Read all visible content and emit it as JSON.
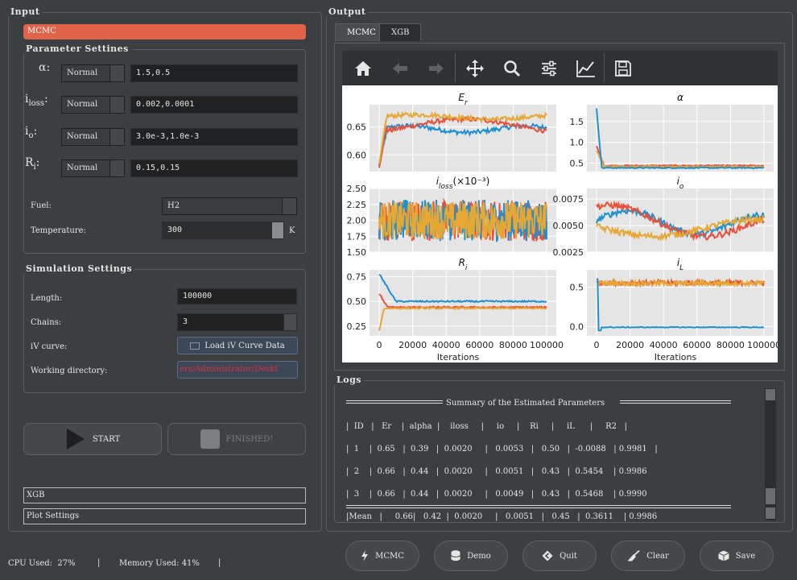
{
  "input": {
    "title": "Input",
    "model_bar": "MCMC",
    "param_title": "Parameter Settines",
    "params": [
      {
        "sym": "α",
        "sub": "",
        "dist": "Normal",
        "value": "1.5,0.5"
      },
      {
        "sym": "i",
        "sub": "loss",
        "dist": "Normal",
        "value": "0.002,0.0001"
      },
      {
        "sym": "i",
        "sub": "o",
        "dist": "Normal",
        "value": "3.0e-3,1.0e-3"
      },
      {
        "sym": "R",
        "sub": "i",
        "dist": "Normal",
        "value": "0.15,0.15"
      }
    ],
    "fuel_label": "Fuel:",
    "fuel_value": "H2",
    "temp_label": "Temperature:",
    "temp_value": "300",
    "temp_unit": "K",
    "sim_title": "Simulation Settings",
    "length_label": "Length:",
    "length_value": "100000",
    "chains_label": "Chains:",
    "chains_value": "3",
    "iv_label": "iV curve:",
    "iv_button": "Load iV Curve Data",
    "wd_label": "Working directory:",
    "wd_value": "ers/Administrator/Deskt",
    "start_button": "START",
    "finished_button": "FINISHED!",
    "xgb_bar": "XGB",
    "plot_settings_bar": "Plot Settings"
  },
  "status": {
    "cpu": "CPU Used:  27%",
    "sep1": "|",
    "mem": "Memory Used: 41%",
    "sep2": "|"
  },
  "output": {
    "title": "Output",
    "tabs": [
      "MCMC",
      "XGB"
    ],
    "toolbar": [
      "home-icon",
      "back-icon",
      "forward-icon",
      "move-icon",
      "zoom-icon",
      "sliders-icon",
      "lines-icon",
      "save-icon"
    ]
  },
  "plots": {
    "colors": {
      "blue": "#1f8fd0",
      "red": "#e8503a",
      "orange": "#e5a834",
      "bg": "#e5e5e5"
    },
    "er": {
      "title": "Er",
      "yticks": [
        "0.65",
        "0.60"
      ]
    },
    "alpha": {
      "title": "α",
      "yticks": [
        "1.5",
        "1.0",
        "0.5"
      ]
    },
    "iloss": {
      "title": "iloss(×10⁻³)",
      "yticks": [
        "2.50",
        "2.25",
        "2.00",
        "1.75",
        "1.50"
      ]
    },
    "io": {
      "title": "io",
      "yticks": [
        "0.0075",
        "0.0050",
        "0.0025"
      ]
    },
    "ri": {
      "title": "Ri",
      "yticks": [
        "0.75",
        "0.50",
        "0.25"
      ]
    },
    "il": {
      "title": "iL",
      "yticks": [
        "0.5",
        "0.0"
      ]
    },
    "xticks": [
      "0",
      "20000",
      "40000",
      "60000",
      "80000",
      "100000"
    ],
    "xlabel": "Iterations"
  },
  "logs": {
    "title": "Logs",
    "header_title": "Summary of the Estimated Parameters",
    "lines": [
      "|  ID   |   Er    |  alpha  |    iloss     |     io     |    Ri     |     iL      |     R2   |",
      "|  1    |  0.65   |  0.39   |  0.0020     |   0.0053   |   0.50   |  -0.0088   | 0.9981   |",
      "|  2    |  0.66   |  0.44   |  0.0020     |   0.0051   |   0.43   |  0.5454    | 0.9986",
      "|  3    |  0.66   |  0.44   |  0.0020     |   0.0049   |   0.43   |  0.5468    | 0.9990",
      "|Mean   |     0.66|   0.42  |  0.0020     |   0.0051   |   0.45   |  0.3611    | 0.9986"
    ]
  },
  "bottom_buttons": [
    "MCMC",
    "Demo",
    "Quit",
    "Clear",
    "Save"
  ]
}
